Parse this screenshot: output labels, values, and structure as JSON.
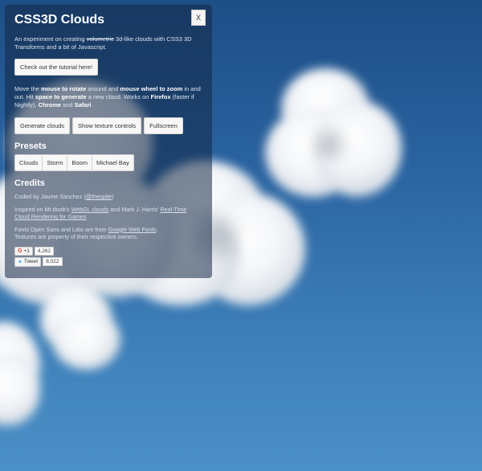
{
  "header": {
    "title": "CSS3D Clouds",
    "close_label": "X"
  },
  "intro": {
    "part1": "An experiment on creating ",
    "strike": "volumetric",
    "part2": " 3d-like clouds with CSS3 3D Transforms and a bit of Javascript."
  },
  "tutorial_button": "Check out the tutorial here!",
  "help": {
    "t1": "Move the ",
    "b1": "mouse to rotate",
    "t2": " around and ",
    "b2": "mouse wheel to zoom",
    "t3": " in and out. Hit ",
    "b3": "space to generate",
    "t4": " a new cloud. Works on ",
    "b4": "Firefox",
    "t5": " (faster if Nightly), ",
    "b5": "Chrome",
    "t6": " and ",
    "b6": "Safari",
    "t7": "."
  },
  "actions": {
    "generate": "Generate clouds",
    "textures": "Show texture controls",
    "fullscreen": "Fullscreen"
  },
  "presets": {
    "heading": "Presets",
    "items": [
      "Clouds",
      "Storm",
      "Boom",
      "Michael Bay"
    ]
  },
  "credits": {
    "heading": "Credits",
    "coded_prefix": "Coded by Jaume Sanchez (",
    "coded_link": "@thespite",
    "coded_suffix": ")",
    "inspired_prefix": "Inspired on Mr.doob's ",
    "inspired_link1": "WebGL clouds",
    "inspired_mid": " and Mark J. Harris' ",
    "inspired_link2": "Real-Time Cloud Rendering for Games",
    "fonts_prefix": "Fonts Open Sans and Lato are from ",
    "fonts_link": "Google Web Fonts",
    "fonts_suffix": ".",
    "textures": "Textures are property of their respective owners."
  },
  "social": {
    "gplus_label": "+1",
    "gplus_count": "4,262",
    "tweet_label": "Tweet",
    "tweet_count": "8,022"
  },
  "colors": {
    "sky_top": "#1d4e86",
    "sky_bottom": "#4b90c6",
    "panel_bg": "rgba(20,40,70,0.55)"
  }
}
